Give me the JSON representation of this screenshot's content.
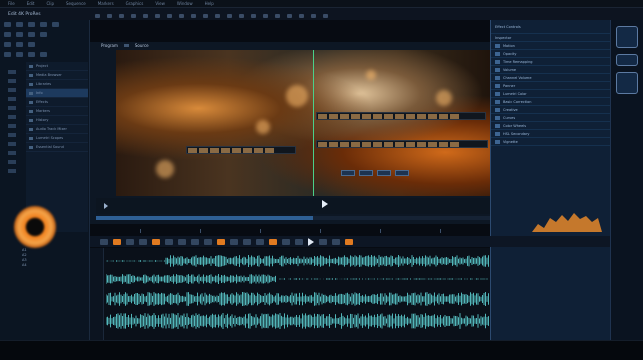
{
  "menu": [
    "File",
    "Edit",
    "Clip",
    "Sequence",
    "Markers",
    "Graphics",
    "View",
    "Window",
    "Help"
  ],
  "window": {
    "title": "Edit 4K ProRes"
  },
  "left_panel": {
    "items": [
      {
        "label": "Project"
      },
      {
        "label": "Media Browser"
      },
      {
        "label": "Libraries"
      },
      {
        "label": "Info",
        "selected": true
      },
      {
        "label": "Effects"
      },
      {
        "label": "Markers"
      },
      {
        "label": "History"
      },
      {
        "label": "Audio Track Mixer"
      },
      {
        "label": "Lumetri Scopes"
      },
      {
        "label": "Essential Sound"
      }
    ]
  },
  "viewer": {
    "label": "Program",
    "tab": "Source",
    "progress": 0.55
  },
  "right_panel": {
    "header": "Effect Controls",
    "subheader": "Inspector",
    "rows": [
      "Motion",
      "Opacity",
      "Time Remapping",
      "Volume",
      "Channel Volume",
      "Panner",
      "Lumetri Color",
      "Basic Correction",
      "Creative",
      "Curves",
      "Color Wheels",
      "HSL Secondary",
      "Vignette"
    ]
  },
  "timeline": {
    "tracks": [
      {
        "name": "A1"
      },
      {
        "name": "A2"
      },
      {
        "name": "A3"
      },
      {
        "name": "A4"
      }
    ]
  },
  "colors": {
    "accent": "#e07a20",
    "waveform": "#5fd3d6",
    "panel": "#0f2036",
    "playhead": "#4ad08a"
  },
  "icons": [
    "play-icon",
    "stop-icon",
    "marker-icon",
    "razor-icon",
    "settings-icon",
    "app-icon"
  ]
}
